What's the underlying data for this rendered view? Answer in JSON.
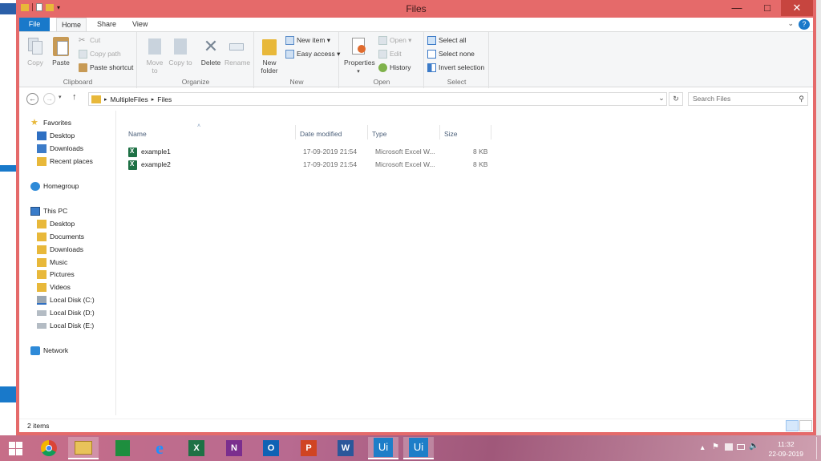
{
  "window": {
    "title": "Files"
  },
  "tabs": {
    "file": "File",
    "home": "Home",
    "share": "Share",
    "view": "View",
    "help": "?"
  },
  "ribbon": {
    "clipboard": {
      "label": "Clipboard",
      "copy": "Copy",
      "paste": "Paste",
      "cut": "Cut",
      "copy_path": "Copy path",
      "paste_shortcut": "Paste shortcut"
    },
    "organize": {
      "label": "Organize",
      "move_to": "Move to",
      "copy_to": "Copy to",
      "delete": "Delete",
      "rename": "Rename"
    },
    "new": {
      "label": "New",
      "new_folder": "New folder",
      "new_item": "New item ▾",
      "easy_access": "Easy access ▾"
    },
    "open": {
      "label": "Open",
      "properties": "Properties",
      "open": "Open ▾",
      "edit": "Edit",
      "history": "History"
    },
    "select": {
      "label": "Select",
      "select_all": "Select all",
      "select_none": "Select none",
      "invert_selection": "Invert selection"
    }
  },
  "address": {
    "crumbs": [
      "MultipleFiles",
      "Files"
    ],
    "search_placeholder": "Search Files"
  },
  "nav": {
    "favorites": "Favorites",
    "fav_items": [
      "Desktop",
      "Downloads",
      "Recent places"
    ],
    "homegroup": "Homegroup",
    "this_pc": "This PC",
    "pc_items": [
      "Desktop",
      "Documents",
      "Downloads",
      "Music",
      "Pictures",
      "Videos",
      "Local Disk (C:)",
      "Local Disk (D:)",
      "Local Disk (E:)"
    ],
    "network": "Network"
  },
  "columns": {
    "name": "Name",
    "date": "Date modified",
    "type": "Type",
    "size": "Size"
  },
  "files": [
    {
      "name": "example1",
      "date": "17-09-2019 21:54",
      "type": "Microsoft Excel W...",
      "size": "8 KB"
    },
    {
      "name": "example2",
      "date": "17-09-2019 21:54",
      "type": "Microsoft Excel W...",
      "size": "8 KB"
    }
  ],
  "status": {
    "count": "2 items"
  },
  "taskbar": {
    "apps": [
      "Windows",
      "Chrome",
      "File Explorer",
      "Store",
      "Internet Explorer",
      "Excel",
      "OneNote",
      "Outlook",
      "PowerPoint",
      "Word",
      "Ui",
      "Ui"
    ],
    "time": "11:32",
    "date": "22-09-2019"
  },
  "colors": {
    "frame": "#e56a6a",
    "accent": "#1979ca",
    "excel": "#1e7145"
  }
}
